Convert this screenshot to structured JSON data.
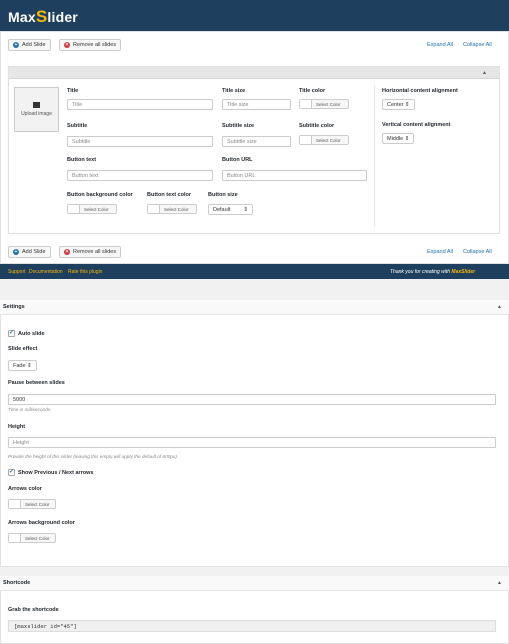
{
  "app": {
    "logo_prefix": "Max",
    "logo_s": "S",
    "logo_suffix": "lider"
  },
  "toolbar": {
    "add_slide": "Add Slide",
    "remove_all": "Remove all slides",
    "expand_all": "Expand All",
    "collapse_all": "Collapse All"
  },
  "slide": {
    "upload_label": "Upload image",
    "title_label": "Title",
    "title_placeholder": "Title",
    "title_size_label": "Title size",
    "title_size_placeholder": "Title size",
    "title_color_label": "Title color",
    "subtitle_label": "Subtitle",
    "subtitle_placeholder": "Subtitle",
    "subtitle_size_label": "Subtitle size",
    "subtitle_size_placeholder": "Subtitle size",
    "subtitle_color_label": "Subtitle color",
    "button_text_label": "Button text",
    "button_text_placeholder": "Button text",
    "button_url_label": "Button URL",
    "button_url_placeholder": "Button URL",
    "button_bg_label": "Button background color",
    "button_text_color_label": "Button text color",
    "button_size_label": "Button size",
    "button_size_value": "Default",
    "h_align_label": "Horizontal content alignment",
    "h_align_value": "Center",
    "v_align_label": "Vertical content alignment",
    "v_align_value": "Middle",
    "select_color": "Select Color"
  },
  "footer": {
    "support": "Support",
    "documentation": "Documentation",
    "rate": "Rate this plugin",
    "thanks_prefix": "Thank you for creating with ",
    "thanks_brand": "MaxSlider"
  },
  "settings": {
    "heading": "Settings",
    "auto_slide": "Auto slide",
    "slide_effect_label": "Slide effect",
    "slide_effect_value": "Fade",
    "pause_label": "Pause between slides",
    "pause_value": "5000",
    "pause_hint": "Time in milliseconds.",
    "height_label": "Height",
    "height_placeholder": "Height",
    "height_hint": "Provide the height of this slider (leaving this empty will apply the default of 600px).",
    "arrows_toggle": "Show Previous / Next arrows",
    "arrows_color_label": "Arrows color",
    "arrows_bg_label": "Arrows background color",
    "select_color": "Select Color"
  },
  "shortcode": {
    "heading": "Shortcode",
    "grab_label": "Grab the shortcode",
    "code": "[maxslider id=\"45\"]"
  },
  "colors": {
    "header_bg": "#1f3f5f",
    "accent": "#f5b800",
    "link": "#2271b1",
    "danger": "#d63638"
  }
}
